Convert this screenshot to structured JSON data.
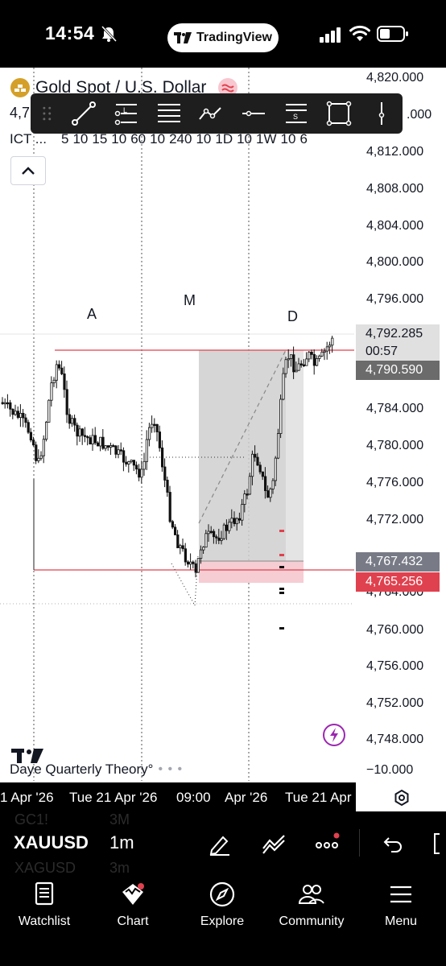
{
  "status_bar": {
    "time": "14:54",
    "app_pill": "TradingView"
  },
  "symbol": {
    "title": "Gold Spot / U.S. Dollar",
    "price_short": "4,7",
    "ict_label": "ICT ...",
    "intervals": [
      "5",
      "10",
      "15",
      "10",
      "60",
      "10",
      "240",
      "10",
      "1D",
      "10",
      "1W",
      "10",
      "6"
    ]
  },
  "drawing_tools": [
    "trend-line",
    "long-position",
    "horizontal-lines",
    "path",
    "horizontal-line",
    "short-position",
    "rectangle",
    "vertical-line"
  ],
  "price_axis": {
    "labels": [
      "4,820.000",
      ".000",
      "4,812.000",
      "4,808.000",
      "4,804.000",
      "4,800.000",
      "4,796.000",
      "4,784.000",
      "4,780.000",
      "4,776.000",
      "4,772.000",
      "4,764.000",
      "4,760.000",
      "4,756.000",
      "4,752.000",
      "4,748.000"
    ],
    "current_price": "4,792.285",
    "countdown": "00:57",
    "tag_dark": "4,790.590",
    "tag_gray": "4,767.432",
    "tag_red": "4,765.256"
  },
  "annotations": {
    "a": "A",
    "m": "M",
    "d": "D"
  },
  "indicator": {
    "name": "Daye Quarterly Theory°",
    "dots": "• • •",
    "value": "−10.000"
  },
  "date_axis": [
    "1 Apr '26",
    "Tue 21 Apr '26",
    "09:00",
    "Apr '26",
    "Tue 21 Apr"
  ],
  "bottom_toolbar": {
    "symbol": "XAUUSD",
    "interval": "1m",
    "ghost_above": [
      "GC1!",
      "3M"
    ],
    "ghost_below": [
      "XAGUSD",
      "3m"
    ]
  },
  "nav": [
    {
      "label": "Watchlist",
      "icon": "watchlist-icon"
    },
    {
      "label": "Chart",
      "icon": "chart-icon"
    },
    {
      "label": "Explore",
      "icon": "compass-icon"
    },
    {
      "label": "Community",
      "icon": "community-icon"
    },
    {
      "label": "Menu",
      "icon": "menu-icon"
    }
  ],
  "colors": {
    "red": "#e0414e",
    "dark": "#000000",
    "zone_gray": "#c8c8c8",
    "bolt_purple": "#9c27b0",
    "gold": "#d4a02a"
  }
}
